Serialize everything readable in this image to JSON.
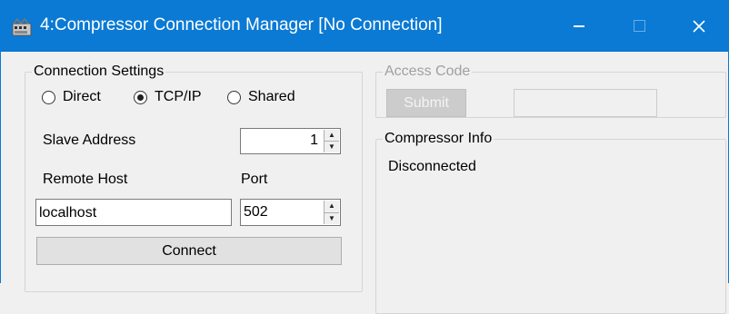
{
  "window": {
    "title": "4:Compressor Connection Manager [No Connection]",
    "titlebar_color": "#0a7ad4",
    "controls": {
      "minimize": "minimize-icon",
      "maximize": "maximize-icon",
      "close": "✕"
    }
  },
  "connection_settings": {
    "legend": "Connection Settings",
    "modes": [
      {
        "label": "Direct",
        "checked": false
      },
      {
        "label": "TCP/IP",
        "checked": true
      },
      {
        "label": "Shared",
        "checked": false
      }
    ],
    "slave_address": {
      "label": "Slave Address",
      "value": "1"
    },
    "remote_host": {
      "label": "Remote Host",
      "value": "localhost"
    },
    "port": {
      "label": "Port",
      "value": "502"
    },
    "connect_button": "Connect"
  },
  "access_code": {
    "legend": "Access Code",
    "submit_button": "Submit",
    "code_value": "",
    "enabled": false
  },
  "compressor_info": {
    "legend": "Compressor Info",
    "status": "Disconnected"
  }
}
